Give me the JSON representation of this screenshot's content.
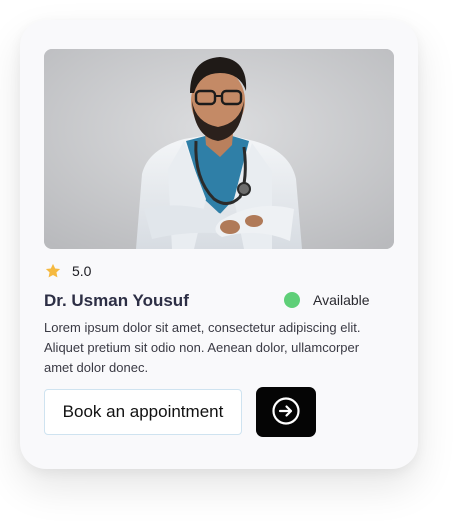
{
  "card": {
    "photo_alt": "Doctor portrait",
    "rating": {
      "icon": "star-icon",
      "value": "5.0",
      "star_color": "#f5b940"
    },
    "doctor_name": "Dr. Usman Yousuf",
    "status": {
      "label": "Available",
      "color": "#5fcf78"
    },
    "description": "Lorem ipsum dolor sit amet, consectetur adipiscing elit. Aliquet pretium sit odio non. Aenean dolor, ullamcorper amet dolor donec.",
    "actions": {
      "book_label": "Book an appointment",
      "arrow_icon": "arrow-right-circle-icon"
    }
  }
}
